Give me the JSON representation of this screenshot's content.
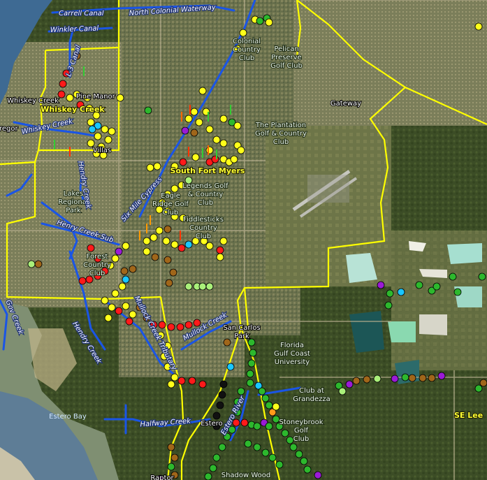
{
  "map": {
    "place_labels": [
      {
        "id": "colonial-cc",
        "lines": [
          "Colonial",
          "Country",
          "Club"
        ]
      },
      {
        "id": "pelican",
        "lines": [
          "Pelican",
          "Preserve",
          "Golf Club"
        ]
      },
      {
        "id": "gateway",
        "lines": [
          "Gateway"
        ]
      },
      {
        "id": "plantation",
        "lines": [
          "The Plantation",
          "Golf & Country",
          "Club"
        ]
      },
      {
        "id": "whiskey-creek-small",
        "lines": [
          "Whiskey Creek"
        ]
      },
      {
        "id": "pine-manor",
        "lines": [
          "Pine Manor"
        ]
      },
      {
        "id": "villas",
        "lines": [
          "Villas"
        ]
      },
      {
        "id": "gregor",
        "lines": [
          "regor"
        ]
      },
      {
        "id": "lakes-park",
        "lines": [
          "Lakes",
          "Regional",
          "Park"
        ]
      },
      {
        "id": "legends",
        "lines": [
          "Legends Golf",
          "& Country",
          "Club"
        ]
      },
      {
        "id": "eagle-ridge",
        "lines": [
          "Eagle",
          "Ridge Golf",
          "Club"
        ]
      },
      {
        "id": "fiddlesticks",
        "lines": [
          "Fiddlesticks",
          "Country",
          "Club"
        ]
      },
      {
        "id": "forest-cc",
        "lines": [
          "Forest",
          "Country",
          "Club"
        ]
      },
      {
        "id": "san-carlos",
        "lines": [
          "San Carlos",
          "Park"
        ]
      },
      {
        "id": "fgcu",
        "lines": [
          "Florida",
          "Gulf Coast",
          "University"
        ]
      },
      {
        "id": "grandezza",
        "lines": [
          "Club at",
          "Grandezza"
        ]
      },
      {
        "id": "estero",
        "lines": [
          "Estero"
        ]
      },
      {
        "id": "stoneybrook",
        "lines": [
          "Stoneybrook",
          "Golf",
          "Club"
        ]
      },
      {
        "id": "raptor",
        "lines": [
          "Raptor"
        ]
      },
      {
        "id": "shadow-wood",
        "lines": [
          "Shadow Wood"
        ]
      }
    ],
    "bold_labels": [
      {
        "id": "whiskey-creek",
        "text": "Whiskey Creek"
      },
      {
        "id": "south-fort-myers",
        "text": "South Fort Myers"
      },
      {
        "id": "se-lee",
        "text": "SE Lee"
      }
    ],
    "water_labels": [
      {
        "id": "carrell-canal",
        "text": "Carrell Canal"
      },
      {
        "id": "north-colonial",
        "text": "North Colonial Waterway"
      },
      {
        "id": "winkler-canal",
        "text": "Winkler Canal"
      },
      {
        "id": "l3-canal",
        "text": "L-3 Canal"
      },
      {
        "id": "whiskey-creek-water",
        "text": "Whiskey Creek"
      },
      {
        "id": "hendry-creek-n",
        "text": "Hendry Creek"
      },
      {
        "id": "six-mile-cypress",
        "text": "Six Mile Cypress"
      },
      {
        "id": "henry-creek-sub",
        "text": "Henry Creek Sub"
      },
      {
        "id": "mullock-creek",
        "text": "Mullock Creek"
      },
      {
        "id": "mullock-creek-tributary",
        "text": "Mullock Creek Tributary"
      },
      {
        "id": "gov-creek",
        "text": "Gov Creek"
      },
      {
        "id": "hendry-creek-s",
        "text": "Hendry Creek"
      },
      {
        "id": "estero-river",
        "text": "Estero River"
      },
      {
        "id": "halfway-creek",
        "text": "Halfway Creek"
      }
    ],
    "bay_label": "Estero Bay",
    "marker_colors": {
      "yellow": "#ffff1a",
      "red": "#ff1a1a",
      "green": "#2db82d",
      "brown": "#a0661a",
      "cyan": "#1ac6ff",
      "purple": "#9b1ad6",
      "lightgreen": "#aaf07a",
      "black": "#111111",
      "orange": "#ff9a1a"
    },
    "boundary_color": "#ffff00",
    "waterway_color": "#1a55e6"
  }
}
